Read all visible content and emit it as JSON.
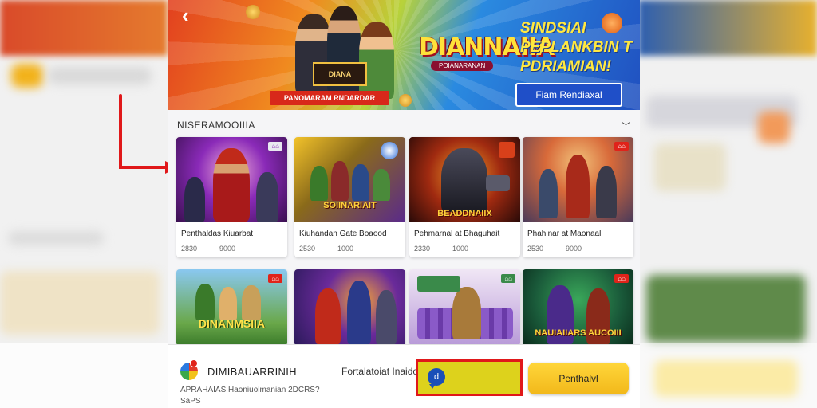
{
  "header": {
    "back_icon": "chevron-left-icon"
  },
  "banner": {
    "game_badge": "DIANA",
    "cta_strip": "PANOMARAM RNDARDAR",
    "logo": "DIANNAIIA",
    "logo_sub": "POIANARANAN",
    "headline": "SINDSIAI PEPLANKBIN T PDRIAMIAN!",
    "button_label": "Fiam Rendiaxal"
  },
  "section": {
    "title": "NISERAMOOIIIA",
    "chevron_icon": "chevron-down-icon"
  },
  "cards": [
    {
      "title": "Penthaldas Kiuarbat",
      "meta_a": "2830",
      "meta_b": "9000",
      "badge": "",
      "img_label": ""
    },
    {
      "title": "Kiuhandan Gate Boaood",
      "meta_a": "2530",
      "meta_b": "1000",
      "badge": "",
      "img_label": "SOIINARIAIT"
    },
    {
      "title": "Pehmarnal at Bhaguhait",
      "meta_a": "2330",
      "meta_b": "1000",
      "badge": "",
      "img_label": "BEADDNAIIX"
    },
    {
      "title": "Phahinar at Maonaal",
      "meta_a": "2530",
      "meta_b": "9000",
      "badge": "",
      "img_label": ""
    }
  ],
  "cards_row2": [
    {
      "badge": "",
      "img_label": "DINANMSIIA"
    },
    {
      "badge": "",
      "img_label": ""
    },
    {
      "badge": "",
      "img_label": ""
    },
    {
      "badge": "",
      "img_label": "NAUIAIIARS AUCOIII"
    }
  ],
  "bottom": {
    "app_name": "DIMIBAUARRINIH",
    "app_desc_line1": "APRAHAIAS Haoniuolmanian 2DCRS?",
    "app_desc_line2": "SaPS",
    "note": "Fortalatoiat Inaido",
    "chat_icon_glyph": "d",
    "primary_label": "Penthalvl"
  },
  "colors": {
    "annotation_red": "#e0181a",
    "accent_yellow": "#f2c21a",
    "banner_blue": "#1f4fc8"
  }
}
